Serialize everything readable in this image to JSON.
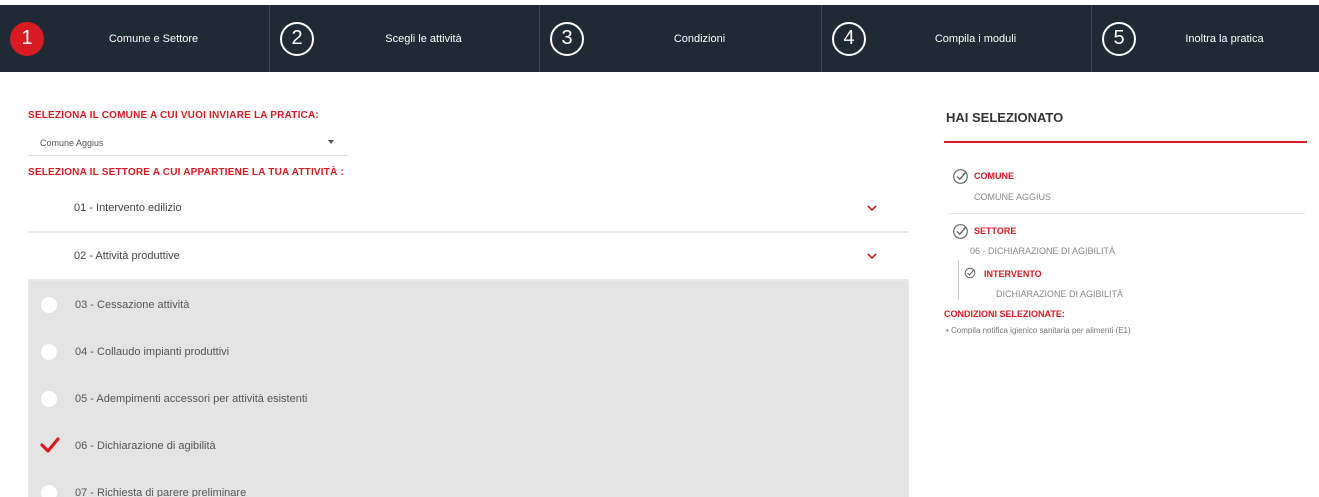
{
  "steps": [
    {
      "num": "1",
      "label": "Comune e Settore",
      "active": true
    },
    {
      "num": "2",
      "label": "Scegli le attività",
      "active": false
    },
    {
      "num": "3",
      "label": "Condizioni",
      "active": false
    },
    {
      "num": "4",
      "label": "Compila i moduli",
      "active": false
    },
    {
      "num": "5",
      "label": "Inoltra la pratica",
      "active": false
    }
  ],
  "comune": {
    "section_title": "SELEZIONA IL COMUNE A CUI VUOI INVIARE LA PRATICA:",
    "selected": "Comune Aggius"
  },
  "settore": {
    "section_title": "SELEZIONA IL SETTORE A CUI APPARTIENE LA TUA ATTIVITÀ :",
    "accordion": [
      {
        "label": "01 - Intervento edilizio",
        "icon": "chevron-down-icon"
      },
      {
        "label": "02 - Attività  produttive",
        "icon": "chevron-down-icon"
      }
    ],
    "options": [
      {
        "label": "03 - Cessazione attività",
        "checked": false
      },
      {
        "label": "04 - Collaudo impianti produttivi",
        "checked": false
      },
      {
        "label": "05 - Adempimenti accessori per attività esistenti",
        "checked": false
      },
      {
        "label": "06 - Dichiarazione di agibilità",
        "checked": true
      },
      {
        "label": "07 - Richiesta di parere preliminare",
        "checked": false
      }
    ]
  },
  "summary": {
    "title": "HAI SELEZIONATO",
    "comune_label": "COMUNE",
    "comune_value": "COMUNE AGGIUS",
    "settore_label": "SETTORE",
    "settore_value": "06 - DICHIARAZIONE DI AGIBILITÀ",
    "intervento_label": "INTERVENTO",
    "intervento_value": "DICHIARAZIONE DI AGIBILITÀ",
    "condizioni_title": "CONDIZIONI SELEZIONATE:",
    "condizioni": [
      "Compila notifica igienico sanitaria per alimenti (E1)"
    ]
  },
  "colors": {
    "accent": "#d81b23",
    "topbar": "#1f2a35",
    "list_bg": "#e4e4e4"
  }
}
